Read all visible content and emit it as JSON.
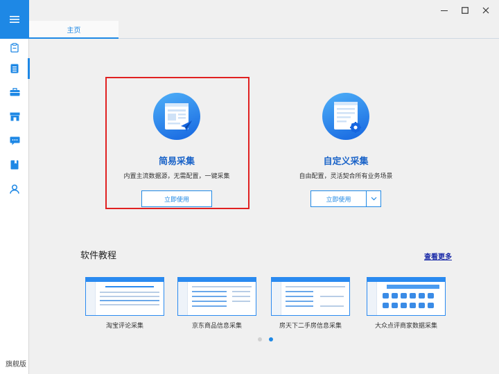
{
  "sidebar": {
    "flag": "旗舰版",
    "items": [
      "menu-icon",
      "clipboard-icon",
      "document-icon",
      "briefcase-icon",
      "store-icon",
      "chat-icon",
      "book-icon",
      "user-icon"
    ]
  },
  "tabs": [
    {
      "label": "主页"
    }
  ],
  "cards": [
    {
      "title": "简易采集",
      "desc": "内置主流数据源，无需配置，一键采集",
      "button": "立即使用"
    },
    {
      "title": "自定义采集",
      "desc": "自由配置，灵活契合所有业务场景",
      "button": "立即使用"
    }
  ],
  "tutorials": {
    "title": "软件教程",
    "more": "查看更多",
    "items": [
      {
        "label": "淘宝评论采集"
      },
      {
        "label": "京东商品信息采集"
      },
      {
        "label": "房天下二手房信息采集"
      },
      {
        "label": "大众点评商家数据采集"
      }
    ]
  },
  "pager": {
    "pages": 2,
    "current": 2
  },
  "colors": {
    "accent": "#1e88e5",
    "highlight": "#e02020"
  }
}
